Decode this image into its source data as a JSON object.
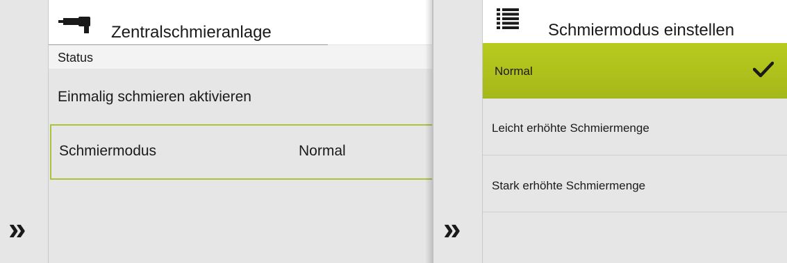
{
  "left_panel": {
    "header": {
      "title": "Zentralschmieranlage",
      "icon": "grease-gun-icon"
    },
    "status_label": "Status",
    "items": {
      "einmalig": "Einmalig schmieren aktivieren",
      "mode_label": "Schmiermodus",
      "mode_value": "Normal"
    },
    "nav_icon": "double-chevron-right-icon",
    "nav_glyph": "»"
  },
  "right_panel": {
    "header": {
      "title": "Schmiermodus einstellen",
      "icon": "list-icon"
    },
    "options": [
      {
        "label": "Normal",
        "selected": true
      },
      {
        "label": "Leicht erhöhte Schmiermenge",
        "selected": false
      },
      {
        "label": "Stark erhöhte Schmiermenge",
        "selected": false
      }
    ],
    "nav_glyph": "»"
  },
  "colors": {
    "accent_green": "#a8c33c",
    "selected_bg": "#b2c51c",
    "background": "#e6e6e6",
    "header_bg": "#ffffff"
  }
}
